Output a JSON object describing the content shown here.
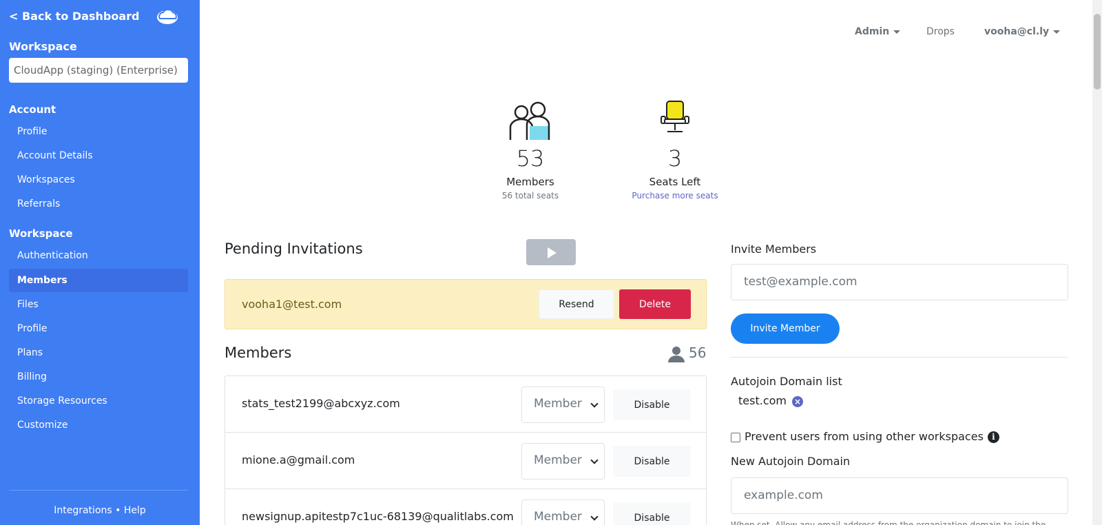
{
  "sidebar": {
    "back_label": "< Back to Dashboard",
    "workspace_heading": "Workspace",
    "workspace_value": "CloudApp (staging) (Enterprise)",
    "account_heading": "Account",
    "account_items": [
      "Profile",
      "Account Details",
      "Workspaces",
      "Referrals"
    ],
    "workspace_section_heading": "Workspace",
    "workspace_items": [
      "Authentication",
      "Members",
      "Files",
      "Profile",
      "Plans",
      "Billing",
      "Storage Resources",
      "Customize"
    ],
    "active_item": "Members",
    "footer": "Integrations • Help"
  },
  "topnav": {
    "admin": "Admin",
    "drops": "Drops",
    "user": "vooha@cl.ly"
  },
  "stats": {
    "members_count": "53",
    "members_label": "Members",
    "members_sub": "56 total seats",
    "seats_count": "3",
    "seats_label": "Seats Left",
    "seats_link": "Purchase more seats"
  },
  "pending": {
    "title": "Pending Invitations",
    "email": "vooha1@test.com",
    "resend_label": "Resend",
    "delete_label": "Delete"
  },
  "members": {
    "title": "Members",
    "count": "56",
    "rows": [
      {
        "email": "stats_test2199@abcxyz.com",
        "role": "Member",
        "action": "Disable"
      },
      {
        "email": "mione.a@gmail.com",
        "role": "Member",
        "action": "Disable"
      },
      {
        "email": "newsignup.apitestp7c1uc-68139@qualitlabs.com",
        "role": "Member",
        "action": "Disable"
      }
    ]
  },
  "invite": {
    "label": "Invite Members",
    "placeholder": "test@example.com",
    "button": "Invite Member"
  },
  "autojoin": {
    "label": "Autojoin Domain list",
    "domain": "test.com",
    "checkbox_label": "Prevent users from using other workspaces",
    "new_label": "New Autojoin Domain",
    "new_placeholder": "example.com",
    "note": "When set, Allow any email address from the organization domain to join the"
  },
  "colors": {
    "sidebar_bg": "#3f7df3",
    "delete_red": "#d8264a",
    "invite_blue": "#1a82f0",
    "pending_bg": "#fcf0c3"
  }
}
